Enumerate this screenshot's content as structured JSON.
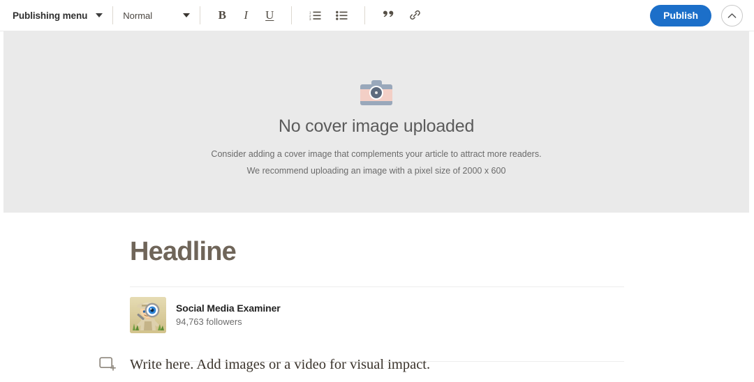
{
  "toolbar": {
    "publishing_menu_label": "Publishing menu",
    "publishing_menu_caret": "chevron-down-icon",
    "style_select_value": "Normal",
    "style_select_caret": "chevron-down-icon",
    "bold_label": "B",
    "italic_label": "I",
    "underline_label": "U",
    "numbered_list_icon": "numbered-list-icon",
    "bulleted_list_icon": "bulleted-list-icon",
    "quote_label": "”",
    "link_icon": "link-icon",
    "publish_label": "Publish",
    "collapse_icon": "chevron-up-icon",
    "publish_button_color": "#1c6fc9",
    "border_color": "#e9e9e9"
  },
  "cover": {
    "icon": "camera-icon",
    "title": "No cover image uploaded",
    "subtitle_line1": "Consider adding a cover image that complements your article to attract more readers.",
    "subtitle_line2": "We recommend uploading an image with a pixel size of 2000 x 600",
    "background_color": "#eaeaea",
    "title_color": "#5b5b5b"
  },
  "article": {
    "headline_placeholder": "Headline",
    "headline_color": "#6f6559",
    "author": {
      "avatar_icon": "avatar-explorer-magnifier",
      "name": "Social Media Examiner",
      "followers": "94,763 followers"
    },
    "body": {
      "add_block_icon": "add-block-icon",
      "placeholder": "Write here. Add images or a video for visual impact."
    },
    "divider_color": "#ededed"
  }
}
